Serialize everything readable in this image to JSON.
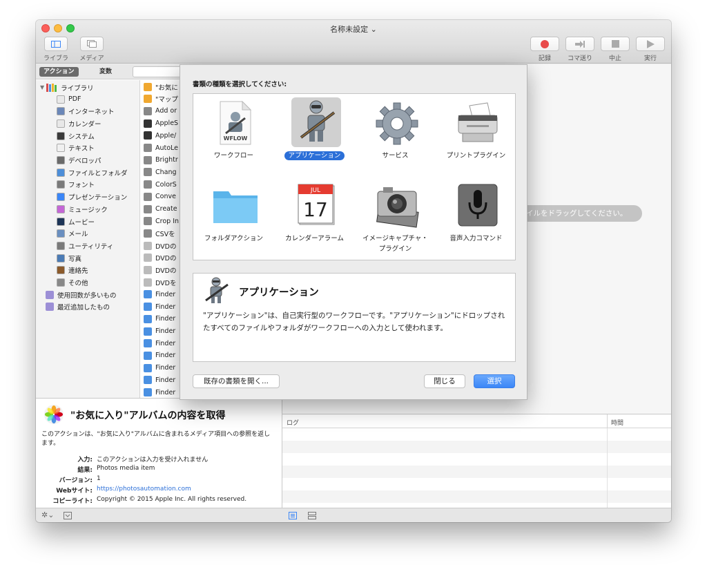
{
  "window": {
    "title": "名称未設定 ⌄"
  },
  "toolbar": {
    "left": [
      {
        "label": "ライブラリ",
        "icon": "library-icon"
      },
      {
        "label": "メディア",
        "icon": "media-icon"
      }
    ],
    "right": [
      {
        "label": "記録",
        "icon": "record-icon"
      },
      {
        "label": "コマ送り",
        "icon": "step-icon"
      },
      {
        "label": "中止",
        "icon": "stop-icon"
      },
      {
        "label": "実行",
        "icon": "run-icon"
      }
    ]
  },
  "library": {
    "tabs": [
      "アクション",
      "変数"
    ],
    "root": "ライブラリ",
    "categories": [
      "PDF",
      "インターネット",
      "カレンダー",
      "システム",
      "テキスト",
      "デベロッパ",
      "ファイルとフォルダ",
      "フォント",
      "プレゼンテーション",
      "ミュージック",
      "ムービー",
      "メール",
      "ユーティリティ",
      "写真",
      "連絡先",
      "その他"
    ],
    "smart": [
      "使用回数が多いもの",
      "最近追加したもの"
    ],
    "actions": [
      "\"お気に",
      "\"マップ",
      "Add or",
      "AppleS",
      "Apple/",
      "AutoLe",
      "Brightr",
      "Chang",
      "ColorS",
      "Conve",
      "Create",
      "Crop In",
      "CSVを",
      "DVDの",
      "DVDの",
      "DVDの",
      "DVDを",
      "Finder",
      "Finder",
      "Finder",
      "Finder",
      "Finder",
      "Finder",
      "Finder",
      "Finder",
      "Finder"
    ]
  },
  "info": {
    "title": "\"お気に入り\"アルバムの内容を取得",
    "description": "このアクションは、\"お気に入り\"アルバムに含まれるメディア項目への参照を返します。",
    "rows": [
      {
        "key": "入力:",
        "value": "このアクションは入力を受け入れません"
      },
      {
        "key": "結果:",
        "value": "Photos media item"
      },
      {
        "key": "バージョン:",
        "value": "1"
      },
      {
        "key": "Webサイト:",
        "value": "https://photosautomation.com"
      },
      {
        "key": "コピーライト:",
        "value": "Copyright © 2015 Apple Inc. All rights reserved."
      }
    ]
  },
  "workflow": {
    "hint": "イルをドラッグしてください。"
  },
  "log": {
    "col_log": "ログ",
    "col_time": "時間"
  },
  "sheet": {
    "prompt": "書類の種類を選択してください:",
    "types": [
      {
        "label": "ワークフロー",
        "icon": "workflow-doc-icon",
        "selected": false
      },
      {
        "label": "アプリケーション",
        "icon": "automator-robot-icon",
        "selected": true
      },
      {
        "label": "サービス",
        "icon": "gear-icon",
        "selected": false
      },
      {
        "label": "プリントプラグイン",
        "icon": "printer-icon",
        "selected": false
      },
      {
        "label": "フォルダアクション",
        "icon": "folder-icon",
        "selected": false
      },
      {
        "label": "カレンダーアラーム",
        "icon": "calendar-icon",
        "selected": false
      },
      {
        "label": "イメージキャプチャ・プラグイン",
        "icon": "camera-icon",
        "selected": false
      },
      {
        "label": "音声入力コマンド",
        "icon": "microphone-icon",
        "selected": false
      }
    ],
    "workflow_badge": "WFLOW",
    "calendar_month": "JUL",
    "calendar_day": "17",
    "detail_title": "アプリケーション",
    "detail_text": "\"アプリケーション\"は、自己実行型のワークフローです。\"アプリケーション\"にドロップされたすべてのファイルやフォルダがワークフローへの入力として使われます。",
    "open_existing": "既存の書類を開く...",
    "close": "閉じる",
    "choose": "選択"
  },
  "colors": {
    "accent": "#3b86f7",
    "selection": "#2b6fd8"
  }
}
